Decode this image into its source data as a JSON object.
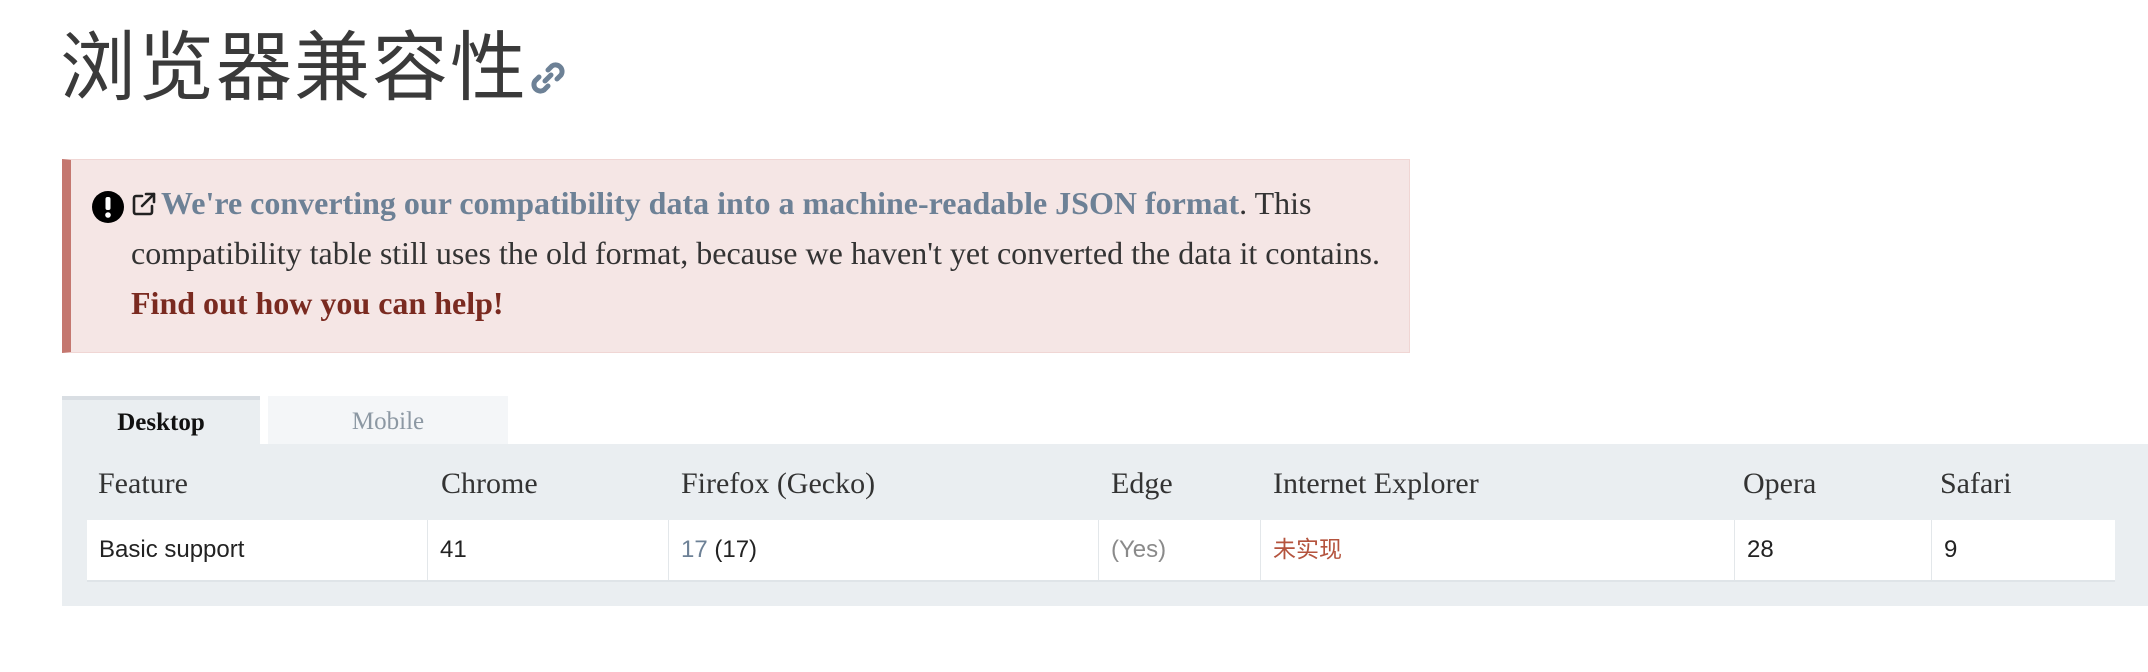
{
  "heading": {
    "title": "浏览器兼容性",
    "anchor_icon": "link-icon"
  },
  "notice": {
    "alert_icon": "exclamation-circle-icon",
    "external_icon": "external-link-icon",
    "link_text": "We're converting our compatibility data into a machine-readable JSON format",
    "body_text": ". This compatibility table still uses the old format, because we haven't yet converted the data it contains. ",
    "help_text": "Find out how you can help!",
    "colors": {
      "background": "#f5e6e5",
      "border": "#c4776f",
      "link": "#6d8196",
      "help": "#7a2a20"
    }
  },
  "tabs": [
    {
      "label": "Desktop",
      "selected": true
    },
    {
      "label": "Mobile",
      "selected": false
    }
  ],
  "table": {
    "headers": [
      "Feature",
      "Chrome",
      "Firefox (Gecko)",
      "Edge",
      "Internet Explorer",
      "Opera",
      "Safari"
    ],
    "rows": [
      {
        "feature": "Basic support",
        "chrome": "41",
        "firefox_link": "17",
        "firefox_rest": " (17)",
        "edge": "(Yes)",
        "ie": "未实现",
        "opera": "28",
        "safari": "9"
      }
    ]
  }
}
